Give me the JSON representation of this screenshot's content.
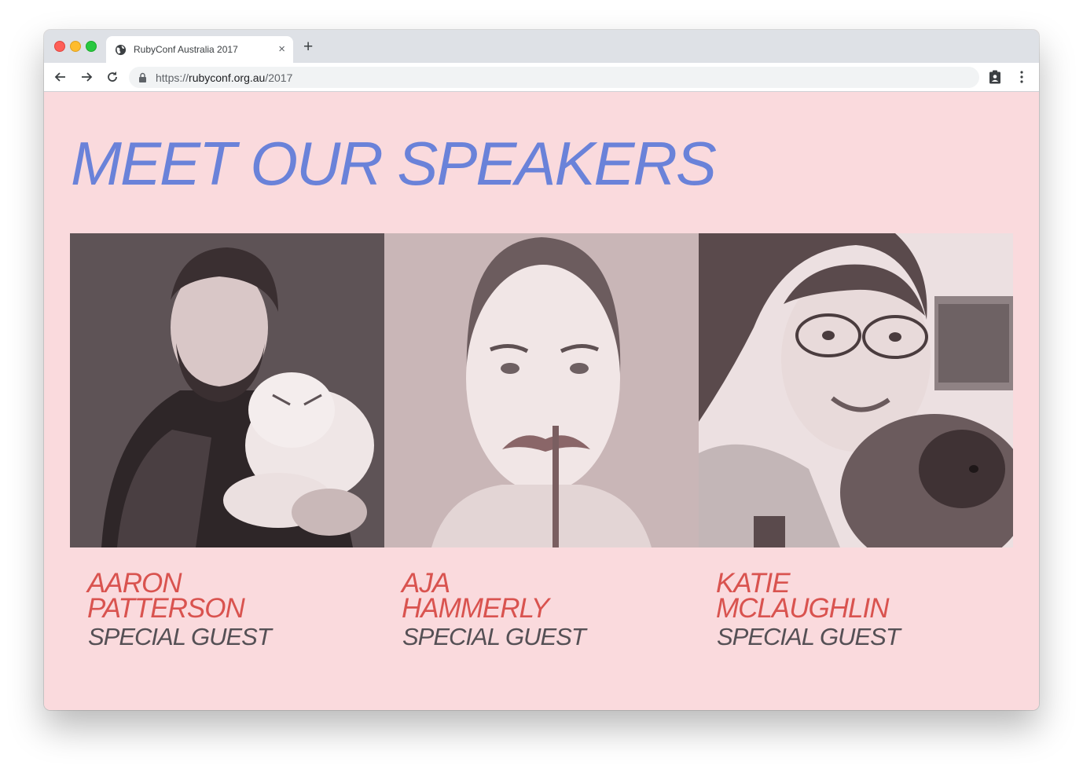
{
  "browser": {
    "tab_title": "RubyConf Australia 2017",
    "url_prefix": "https://",
    "url_host": "rubyconf.org.au",
    "url_path": "/2017",
    "new_tab_label": "+"
  },
  "page": {
    "heading": "MEET OUR SPEAKERS",
    "speakers": [
      {
        "first_name": "AARON",
        "last_name": "PATTERSON",
        "role": "SPECIAL GUEST"
      },
      {
        "first_name": "AJA",
        "last_name": "HAMMERLY",
        "role": "SPECIAL GUEST"
      },
      {
        "first_name": "KATIE",
        "last_name": "MCLAUGHLIN",
        "role": "SPECIAL GUEST"
      }
    ]
  },
  "colors": {
    "background": "#fadadd",
    "heading": "#6a82d9",
    "speaker_name": "#d9534f",
    "speaker_role": "#555055"
  },
  "icons": {
    "favicon": "globe-icon",
    "back": "back-arrow-icon",
    "forward": "forward-arrow-icon",
    "reload": "reload-icon",
    "lock": "lock-icon",
    "extension": "clipboard-person-icon",
    "menu": "kebab-menu-icon"
  }
}
